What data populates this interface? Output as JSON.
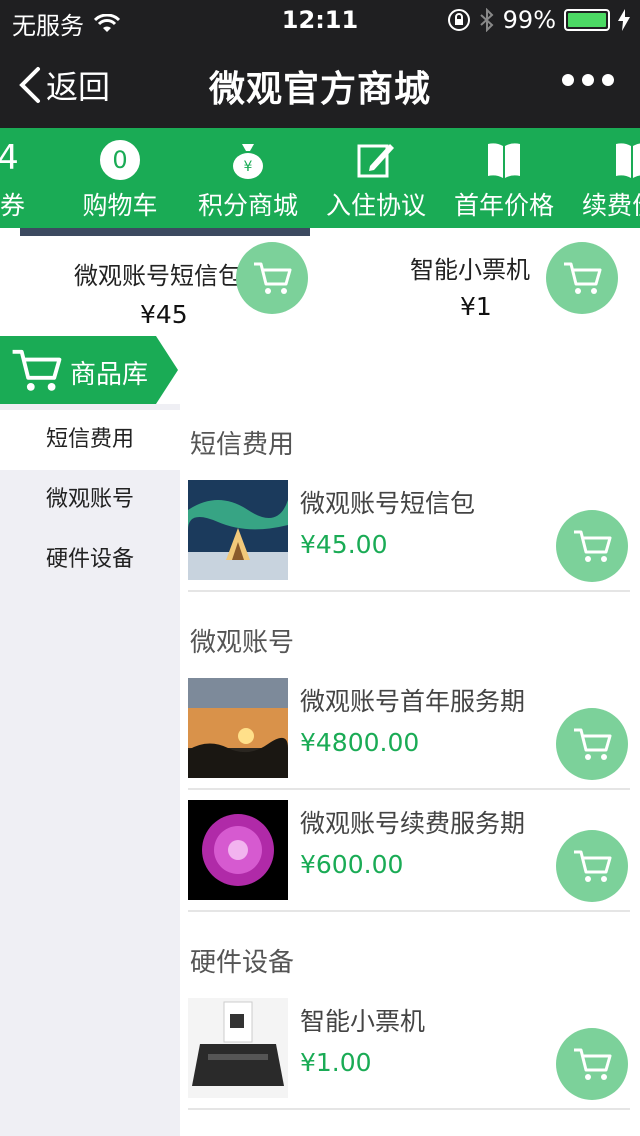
{
  "status_bar": {
    "carrier": "无服务",
    "time": "12:11",
    "battery": "99%"
  },
  "nav": {
    "back_label": "返回",
    "title": "微观官方商城"
  },
  "tabs": [
    {
      "label": "票券",
      "icon": "ticket-count-icon",
      "badge": "4"
    },
    {
      "label": "购物车",
      "icon": "cart-count-icon",
      "badge": "0"
    },
    {
      "label": "积分商城",
      "icon": "money-bag-icon"
    },
    {
      "label": "入住协议",
      "icon": "edit-icon"
    },
    {
      "label": "首年价格",
      "icon": "book-icon"
    },
    {
      "label": "续费价格",
      "icon": "book-icon"
    }
  ],
  "featured": [
    {
      "name": "微观账号短信包",
      "price": "¥45"
    },
    {
      "name": "智能小票机",
      "price": "¥1"
    }
  ],
  "ribbon": {
    "label": "商品库"
  },
  "sidebar": {
    "items": [
      {
        "label": "短信费用",
        "active": true
      },
      {
        "label": "微观账号",
        "active": false
      },
      {
        "label": "硬件设备",
        "active": false
      }
    ]
  },
  "sections": [
    {
      "title": "短信费用",
      "products": [
        {
          "name": "微观账号短信包",
          "price": "¥45.00",
          "thumb": "aurora-tent-image"
        }
      ]
    },
    {
      "title": "微观账号",
      "products": [
        {
          "name": "微观账号首年服务期",
          "price": "¥4800.00",
          "thumb": "sunset-image"
        },
        {
          "name": "微观账号续费服务期",
          "price": "¥600.00",
          "thumb": "purple-flower-image"
        }
      ]
    },
    {
      "title": "硬件设备",
      "products": [
        {
          "name": "智能小票机",
          "price": "¥1.00",
          "thumb": "receipt-printer-image"
        }
      ]
    }
  ],
  "colors": {
    "brand_green": "#1aab55",
    "cart_green": "#7cd19a",
    "nav_dark": "#1f1f21",
    "sidebar_bg": "#efeff4"
  }
}
